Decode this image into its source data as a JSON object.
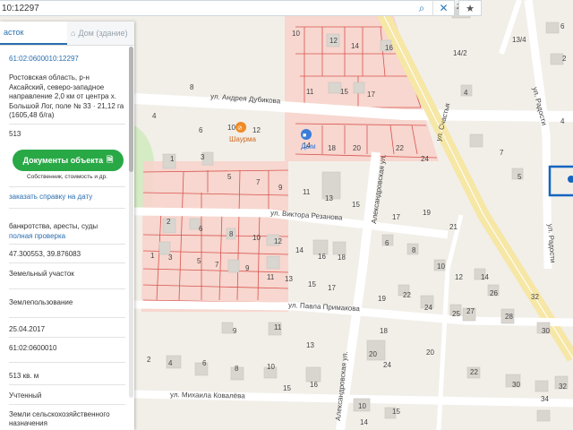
{
  "search": {
    "query": "10:12297"
  },
  "icons": {
    "search": "search-icon",
    "close": "close-icon",
    "favorite": "star-icon",
    "house": "house-icon",
    "document": "document-icon",
    "cafe": "fork-knife-icon",
    "shop": "shopping-cart-icon"
  },
  "panel": {
    "tabs": [
      {
        "label": "асток"
      },
      {
        "label": "Дом (здание)"
      }
    ],
    "cadastral_number": "61:02:0600010:12297",
    "address": "Ростовская область, р-н Аксайский, северо-западное направление 2,0 км от центра х. Большой Лог, поле № 33 · 21,12 га (1605,48 б/га)",
    "code": "513",
    "documents_button": "Документы объекта",
    "documents_sub": "Собственник, стоимость и др.",
    "order_link": "заказать справку на дату",
    "bankruptcy_text": "банкротства, аресты, суды",
    "full_check_link": "полная проверка",
    "coordinates": "47.300553, 39.876083",
    "type": "Земельный участок",
    "use": "Землепользование",
    "date": "25.04.2017",
    "quarter": "61:02:0600010",
    "area": "513 кв. м",
    "status": "Учтенный",
    "category_line1": "Земли сельскохозяйственного",
    "category_line2": "назначения"
  },
  "streets": {
    "dubikova": "ул. Андрея Дубикова",
    "rezanova": "ул. Виктора Резанова",
    "primakova": "ул. Павла Примакова",
    "kovaleva": "ул. Михаила Ковалёва",
    "aleksandrovskaya1": "Александровская ул.",
    "aleksandrovskaya2": "Александровская ул.",
    "schastya": "ул. Счастья",
    "radosti1": "ул. Радости",
    "radosti2": "ул. Радости"
  },
  "pois": {
    "shaurma": "Шаурма",
    "dym": "Дым"
  },
  "colors": {
    "parcel_fill": "#f7d4cc",
    "parcel_line": "#d9534f",
    "road": "#ffffff",
    "main_road": "#f6e7a6",
    "building": "#d9d6d0",
    "accent": "#2a6fb0",
    "green": "#29a846",
    "selected": "#1565c0"
  }
}
